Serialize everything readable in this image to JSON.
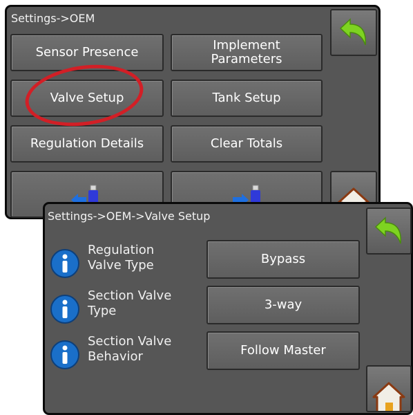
{
  "top_screen": {
    "breadcrumb": "Settings->OEM",
    "buttons": {
      "sensor_presence": "Sensor Presence",
      "implement_parameters_line1": "Implement",
      "implement_parameters_line2": "Parameters",
      "valve_setup": "Valve Setup",
      "tank_setup": "Tank Setup",
      "regulation_details": "Regulation Details",
      "clear_totals": "Clear Totals"
    },
    "icons": {
      "back": "back-arrow-icon",
      "home": "home-icon",
      "export": "usb-export-icon",
      "import": "usb-import-icon"
    }
  },
  "bottom_screen": {
    "breadcrumb": "Settings->OEM->Valve Setup",
    "rows": [
      {
        "label_line1": "Regulation",
        "label_line2": "Valve Type",
        "value": "Bypass"
      },
      {
        "label_line1": "Section Valve",
        "label_line2": "Type",
        "value": "3-way"
      },
      {
        "label_line1": "Section Valve",
        "label_line2": "Behavior",
        "value": "Follow Master"
      }
    ],
    "icons": {
      "info": "info-icon",
      "back": "back-arrow-icon",
      "home": "home-icon"
    }
  },
  "colors": {
    "panel_bg": "#565656",
    "button_bg": "#666666",
    "back_arrow": "#7ed321",
    "usb_arrow": "#1e6fe0",
    "info_blue": "#1a6fc9",
    "highlight": "#d21f26"
  }
}
